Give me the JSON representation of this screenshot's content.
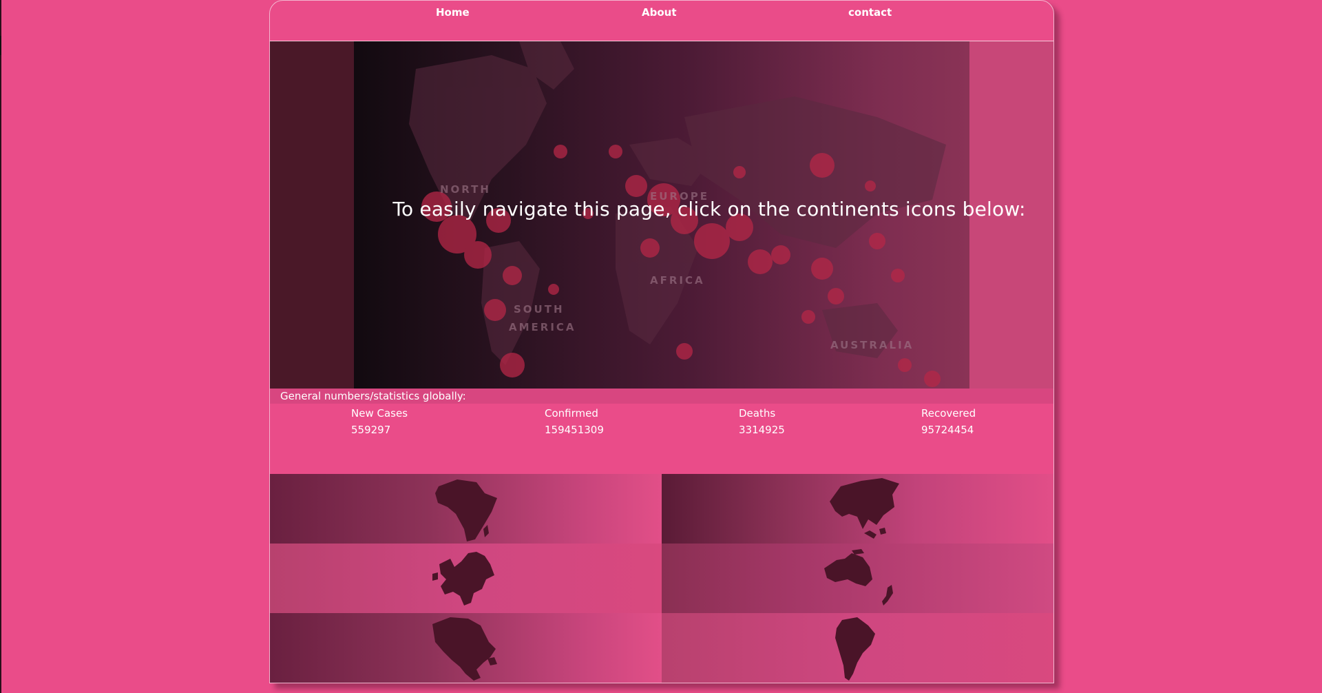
{
  "nav": {
    "home": "Home",
    "about": "About",
    "contact": "contact"
  },
  "hero": {
    "title": "To easily navigate this page, click on the continents icons below:",
    "map_labels": {
      "north": "NORTH",
      "europe": "EUROPE",
      "africa": "AFRICA",
      "south": "SOUTH",
      "america": "AMERICA",
      "australia": "AUSTRALIA"
    }
  },
  "stats": {
    "heading": "General numbers/statistics globally:",
    "items": [
      {
        "label": "New Cases",
        "value": "559297"
      },
      {
        "label": "Confirmed",
        "value": "159451309"
      },
      {
        "label": "Deaths",
        "value": "3314925"
      },
      {
        "label": "Recovered",
        "value": "95724454"
      }
    ]
  },
  "continents": [
    {
      "name": "africa",
      "icon": "africa-icon"
    },
    {
      "name": "asia",
      "icon": "asia-icon"
    },
    {
      "name": "europe",
      "icon": "europe-icon"
    },
    {
      "name": "australia",
      "icon": "australia-icon"
    },
    {
      "name": "north-america",
      "icon": "north-america-icon"
    },
    {
      "name": "south-america",
      "icon": "south-america-icon"
    }
  ],
  "colors": {
    "background": "#ea4c89",
    "silhouette": "#4a1428",
    "text": "#ffffff"
  }
}
